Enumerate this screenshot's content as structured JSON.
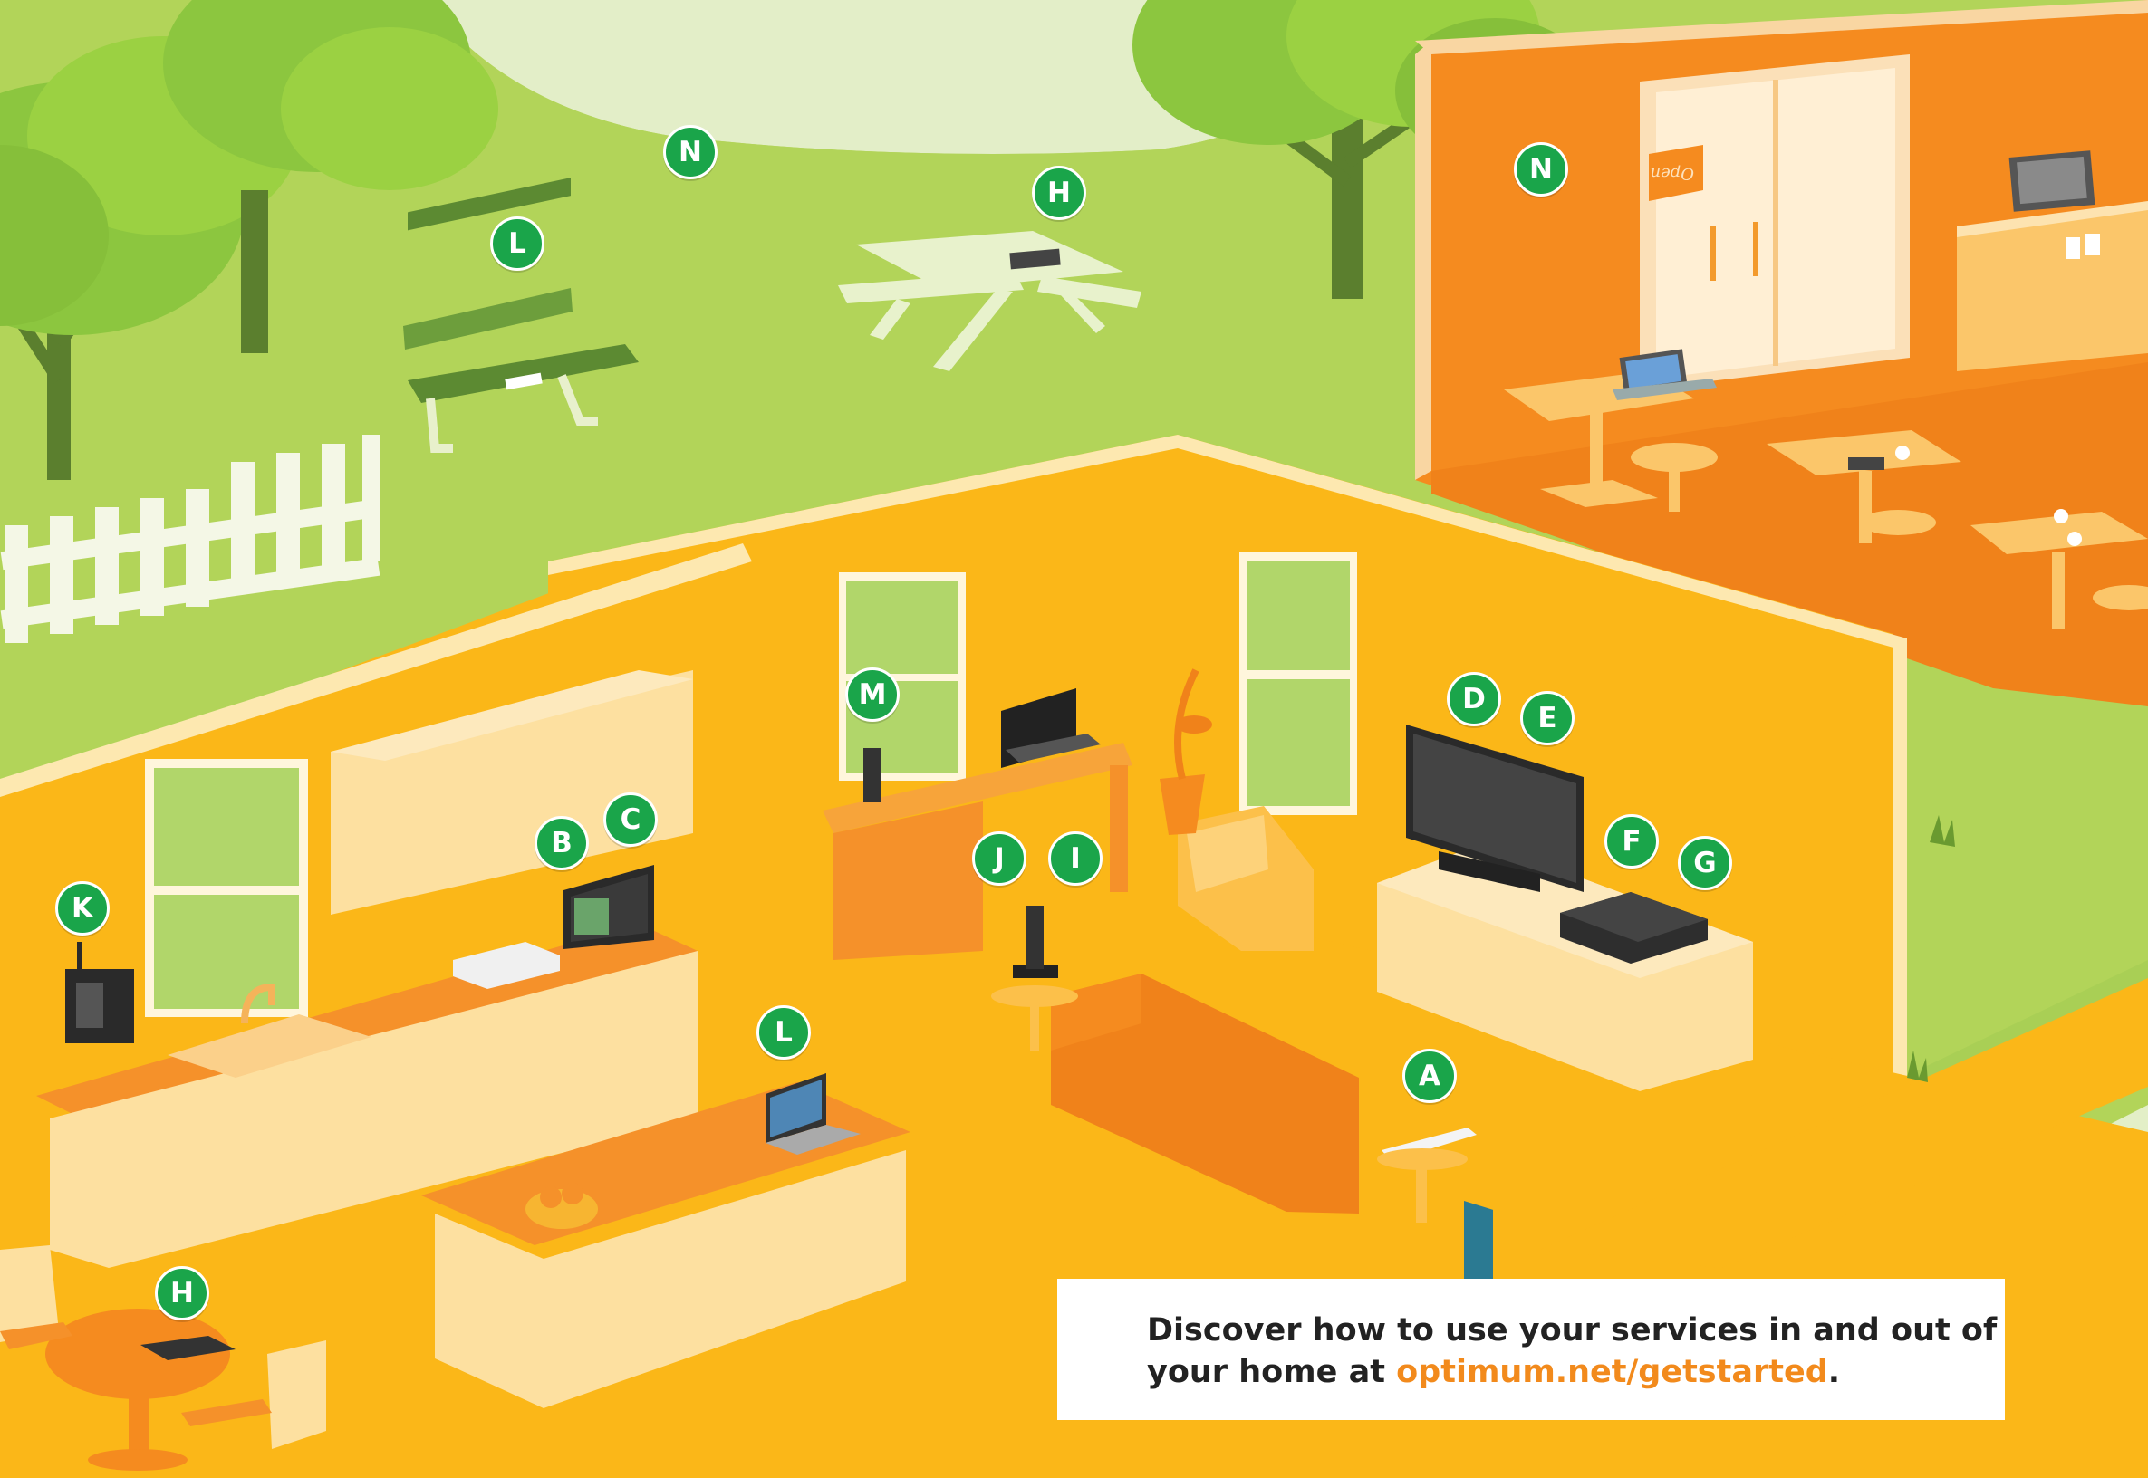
{
  "colors": {
    "grass": "#b5d65b",
    "grass_dark": "#98c44a",
    "house_floor": "#fbb718",
    "house_wall": "#f5a21a",
    "cafe": "#f58b1f",
    "marker_green": "#1aa54a",
    "link_orange": "#f28a1c"
  },
  "markers": [
    {
      "id": "marker-n-yard",
      "label": "N",
      "place": "backyard"
    },
    {
      "id": "marker-l-bench",
      "label": "L",
      "place": "park bench"
    },
    {
      "id": "marker-h-picnic",
      "label": "H",
      "place": "picnic table"
    },
    {
      "id": "marker-n-cafe",
      "label": "N",
      "place": "cafe"
    },
    {
      "id": "marker-m-modem",
      "label": "M",
      "place": "desk"
    },
    {
      "id": "marker-d-tv",
      "label": "D",
      "place": "living room tv"
    },
    {
      "id": "marker-e-tv",
      "label": "E",
      "place": "living room tv"
    },
    {
      "id": "marker-b-kitchen",
      "label": "B",
      "place": "kitchen tv"
    },
    {
      "id": "marker-c-kitchen",
      "label": "C",
      "place": "kitchen tv"
    },
    {
      "id": "marker-f-box",
      "label": "F",
      "place": "cable box"
    },
    {
      "id": "marker-g-box",
      "label": "G",
      "place": "cable box"
    },
    {
      "id": "marker-j-phone",
      "label": "J",
      "place": "cordless phone"
    },
    {
      "id": "marker-i-phone",
      "label": "I",
      "place": "cordless phone"
    },
    {
      "id": "marker-k-wall",
      "label": "K",
      "place": "wall phone"
    },
    {
      "id": "marker-l-laptop",
      "label": "L",
      "place": "kitchen laptop"
    },
    {
      "id": "marker-a-remote",
      "label": "A",
      "place": "remote"
    },
    {
      "id": "marker-h-tablet",
      "label": "H",
      "place": "dining tablet"
    }
  ],
  "cafe_sign": "Open",
  "info": {
    "line1": "Discover how to use your services in and out of",
    "line2_prefix": "your home at ",
    "link": "optimum.net/getstarted",
    "line2_suffix": "."
  }
}
